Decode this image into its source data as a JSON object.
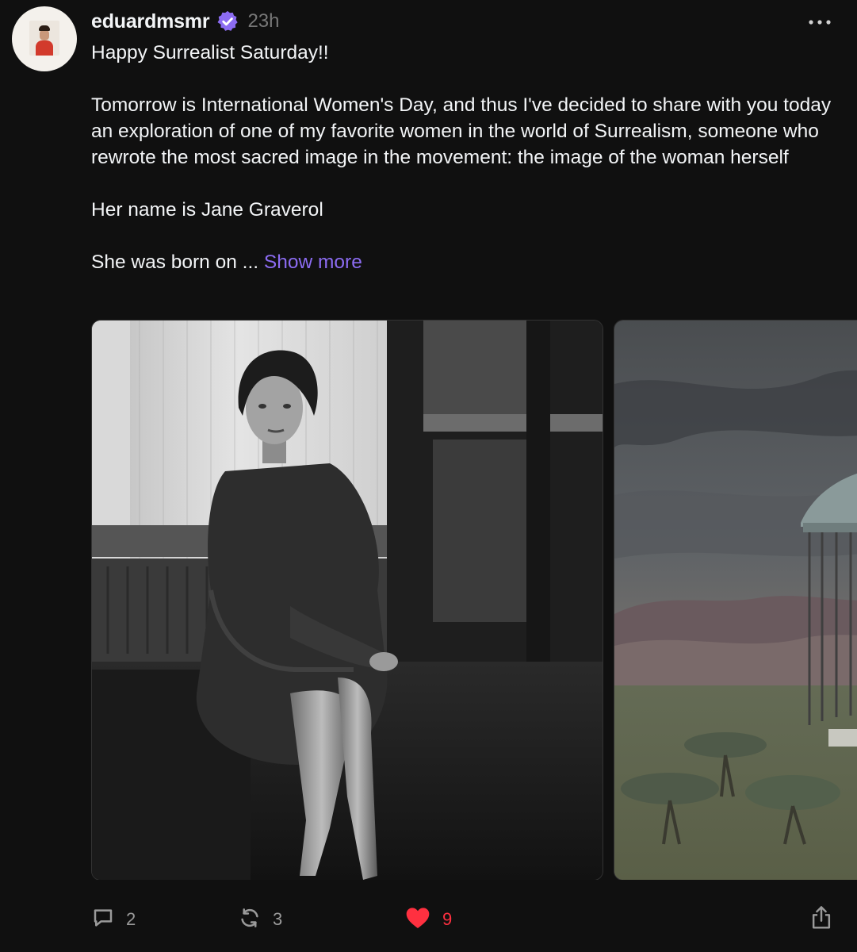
{
  "post": {
    "username": "eduardmsmr",
    "timestamp": "23h",
    "paragraphs": [
      "Happy Surrealist Saturday!!",
      "Tomorrow is International Women's Day, and thus I've decided to share with you today an exploration of one of my favorite women in the world of Surrealism, someone who rewrote the most sacred image in the movement: the image of the woman herself",
      "Her name is Jane Graverol",
      "She was born on ..."
    ],
    "show_more": "Show more",
    "media": [
      {
        "icon": "photo-woman-seated"
      },
      {
        "icon": "painting-landscape-cage"
      }
    ],
    "actions": {
      "replies": "2",
      "reposts": "3",
      "likes": "9"
    }
  },
  "colors": {
    "background": "#101010",
    "text": "#f3f5f7",
    "muted": "#777777",
    "link": "#8c6cf2",
    "verified": "#8c6cf2",
    "like": "#ff3040"
  },
  "icons": {
    "verified": "verified-badge-icon",
    "more": "more-dots-icon",
    "reply": "comment-icon",
    "repost": "repost-icon",
    "like": "heart-icon",
    "share": "share-icon"
  }
}
